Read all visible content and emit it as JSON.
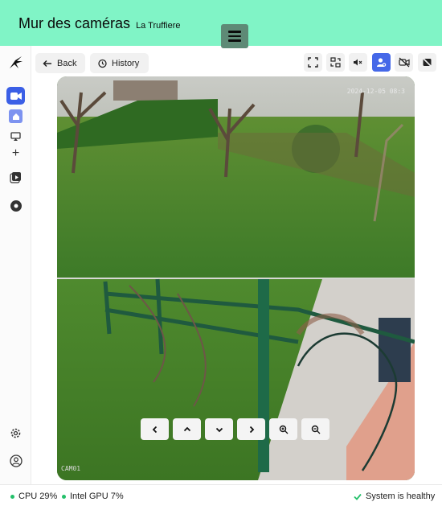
{
  "header": {
    "title": "Mur des caméras",
    "subtitle": "La Truffiere",
    "menu_icon": "hamburger-icon"
  },
  "sidebar": {
    "items": [
      {
        "icon": "logo-icon"
      },
      {
        "icon": "video-camera-icon",
        "active": true
      },
      {
        "icon": "home-icon",
        "active": true
      },
      {
        "icon": "cast-icon"
      },
      {
        "icon": "plus-icon"
      },
      {
        "icon": "replay-icon"
      },
      {
        "icon": "disc-icon"
      },
      {
        "icon": "gear-icon"
      },
      {
        "icon": "user-icon"
      }
    ]
  },
  "toolbar": {
    "back_label": "Back",
    "history_label": "History",
    "icons": [
      "fullscreen-icon",
      "switch-layout-icon",
      "mute-icon",
      "person-detect-icon",
      "camera-off-icon",
      "privacy-off-icon"
    ]
  },
  "video": {
    "timestamp": "2024-12-05 08:3",
    "camera_label": "CAM01"
  },
  "ptz": {
    "buttons": [
      "left-arrow-icon",
      "up-arrow-icon",
      "down-arrow-icon",
      "right-arrow-icon",
      "zoom-in-icon",
      "zoom-out-icon"
    ]
  },
  "status": {
    "cpu": "CPU 29%",
    "gpu": "Intel GPU 7%",
    "health": "System is healthy"
  },
  "colors": {
    "header_bg": "#80f4c6",
    "accent": "#4568e8",
    "ok": "#23c06a"
  }
}
